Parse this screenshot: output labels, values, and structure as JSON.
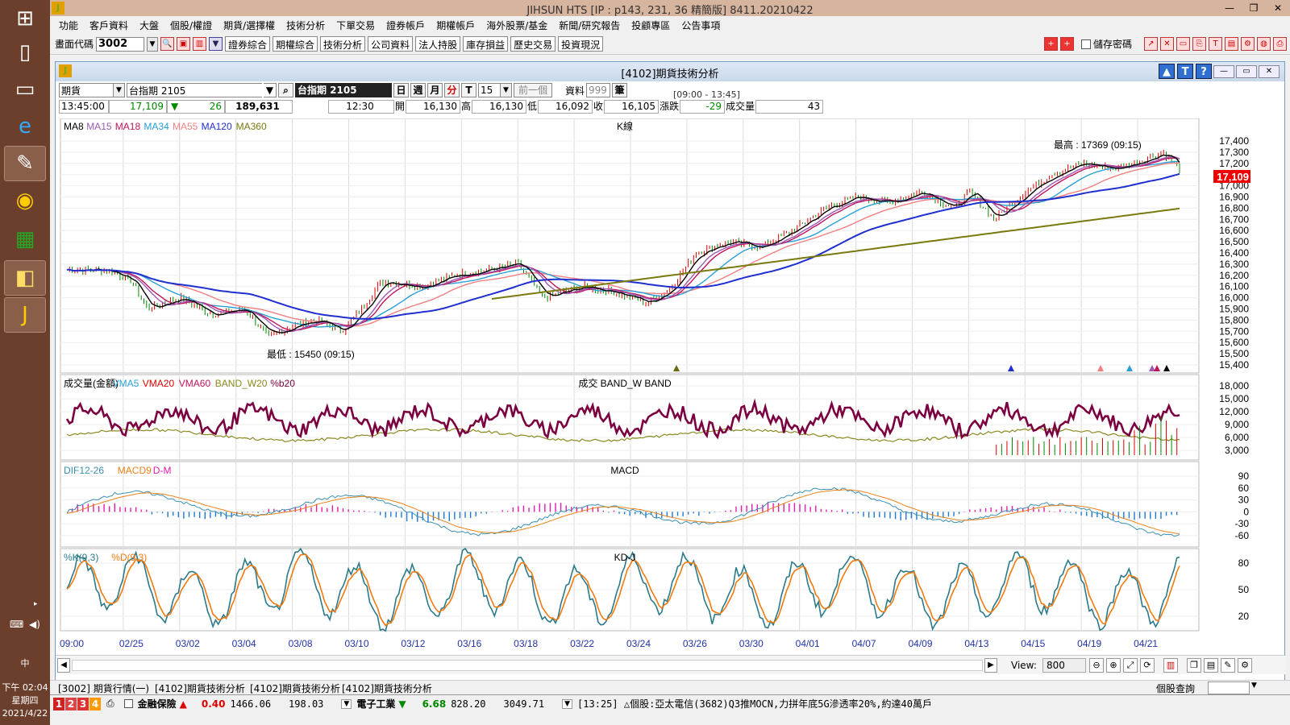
{
  "window": {
    "title": "JIHSUN HTS     [IP : p143, 231, 36 精簡版] 8411.20210422"
  },
  "taskbar": {
    "clock_time": "下午 02:04",
    "clock_day": "星期四",
    "clock_date": "2021/4/22",
    "ime": "中"
  },
  "menu": [
    "功能",
    "客戶資料",
    "大盤",
    "個股/權證",
    "期貨/選擇權",
    "技術分析",
    "下單交易",
    "證券帳戶",
    "期權帳戶",
    "海外股票/基金",
    "新聞/研究報告",
    "投顧專區",
    "公告事項"
  ],
  "toolbar": {
    "code_label": "畫面代碼",
    "code_value": "3002",
    "buttons": [
      "證券綜合",
      "期權綜合",
      "技術分析",
      "公司資料",
      "法人持股",
      "庫存損益",
      "歷史交易",
      "投資現況"
    ],
    "save_password": "儲存密碼"
  },
  "inner_window": {
    "title": "[4102]期貨技術分析"
  },
  "controls": {
    "market": "期貨",
    "contract": "台指期 2105",
    "contract_display": "台指期 2105",
    "periods": [
      "日",
      "週",
      "月",
      "分",
      "T"
    ],
    "interval": "15",
    "prev_label": "前一個",
    "data_label": "資料",
    "data_count": "999",
    "unit": "筆",
    "session": "[09:00 - 13:45]"
  },
  "quote": {
    "time": "13:45:00",
    "price": "17,109",
    "change": "26",
    "volume_total": "189,631",
    "bar_time": "12:30",
    "open_label": "開",
    "open": "16,130",
    "high_label": "高",
    "high": "16,130",
    "low_label": "低",
    "low": "16,092",
    "close_label": "收",
    "close": "16,105",
    "chg_label": "漲跌",
    "chg": "-29",
    "vol_label": "成交量",
    "vol": "43"
  },
  "chart_data": [
    {
      "type": "line",
      "title": "K線",
      "legend": [
        "MA8",
        "MA15",
        "MA18",
        "MA34",
        "MA55",
        "MA120",
        "MA360"
      ],
      "colors": {
        "MA8": "#000000",
        "MA15": "#9b59b6",
        "MA18": "#c0155a",
        "MA34": "#2a9fd6",
        "MA55": "#f08080",
        "MA120": "#1f2fd0",
        "MA360": "#7a7a10"
      },
      "yticks": [
        "17,400",
        "17,300",
        "17,200",
        "17,100",
        "17,000",
        "16,900",
        "16,800",
        "16,700",
        "16,600",
        "16,500",
        "16,400",
        "16,300",
        "16,200",
        "16,100",
        "16,000",
        "15,900",
        "15,800",
        "15,700",
        "15,600",
        "15,500",
        "15,400"
      ],
      "ylim": [
        15400,
        17400
      ],
      "last_price": "17,109",
      "annotation_high": "最高 : 17369 (09:15)",
      "annotation_low": "最低 : 15450 (09:15)",
      "x_labels": [
        "09:00",
        "02/25",
        "03/02",
        "03/04",
        "03/08",
        "03/10",
        "03/12",
        "03/16",
        "03/18",
        "03/22",
        "03/24",
        "03/26",
        "03/30",
        "04/01",
        "04/07",
        "04/09",
        "04/13",
        "04/15",
        "04/19",
        "04/21"
      ]
    },
    {
      "type": "line",
      "title": "成交  BAND_W  BAND",
      "legend": [
        "成交量(金額)",
        "VMA5",
        "VMA20",
        "VMA60",
        "BAND_W20",
        "%b20"
      ],
      "yticks": [
        "18,000",
        "15,000",
        "12,000",
        "9,000",
        "6,000",
        "3,000"
      ],
      "ylim": [
        0,
        20000
      ]
    },
    {
      "type": "bar",
      "title": "MACD",
      "legend": [
        "DIF12-26",
        "MACD9",
        "D-M"
      ],
      "yticks": [
        "90",
        "60",
        "30",
        "0",
        "-30",
        "-60"
      ],
      "ylim": [
        -80,
        110
      ]
    },
    {
      "type": "line",
      "title": "KD-J",
      "legend": [
        "%K(9,3)",
        "%D(9,3)"
      ],
      "yticks": [
        "80",
        "50",
        "20"
      ],
      "ylim": [
        0,
        100
      ]
    }
  ],
  "scroll": {
    "view_label": "View:",
    "view_value": "800"
  },
  "tabs": [
    "[3002] 期貨行情(一)",
    "[4102]期貨技術分析",
    "[4102]期貨技術分析",
    "[4102]期貨技術分析"
  ],
  "right_query": "個股查詢",
  "ticker": {
    "nums": [
      "1",
      "2",
      "3",
      "4"
    ],
    "sector1": "金融保險",
    "sector1_chg": "0.40",
    "sector1_idx": "1466.06",
    "sector1_vol": "198.03",
    "sector2": "電子工業",
    "sector2_chg": "6.68",
    "sector2_idx": "828.20",
    "sector2_vol": "3049.71",
    "news": "[13:25] △個股:亞太電信(3682)Q3推MOCN,力拼年底5G滲透率20%,約達40萬戶"
  }
}
